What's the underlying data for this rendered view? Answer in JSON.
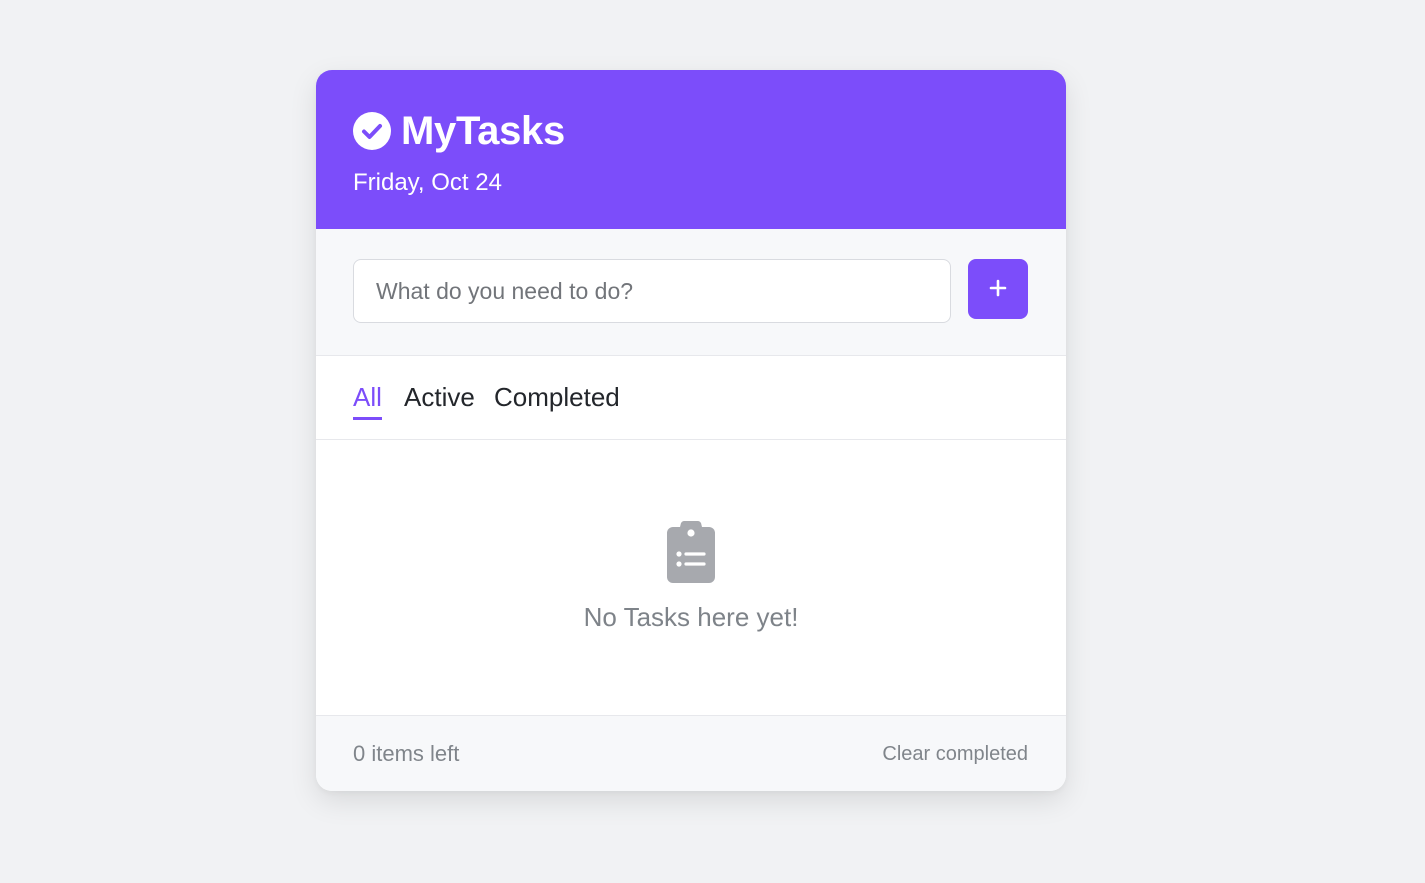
{
  "app": {
    "title": "MyTasks",
    "date": "Friday, Oct 24",
    "brand_icon": "check-circle-icon"
  },
  "add_task": {
    "placeholder": "What do you need to do?",
    "value": "",
    "button_icon": "plus-icon"
  },
  "filters": [
    {
      "label": "All",
      "active": true
    },
    {
      "label": "Active",
      "active": false
    },
    {
      "label": "Completed",
      "active": false
    }
  ],
  "empty_state": {
    "icon": "clipboard-list-icon",
    "message": "No Tasks here yet!"
  },
  "footer": {
    "items_left": "0 items left",
    "clear_label": "Clear completed"
  },
  "colors": {
    "accent": "#7c4dfa",
    "background": "#f1f2f4",
    "muted_text": "#80858b",
    "empty_icon": "#a7a9ae"
  }
}
